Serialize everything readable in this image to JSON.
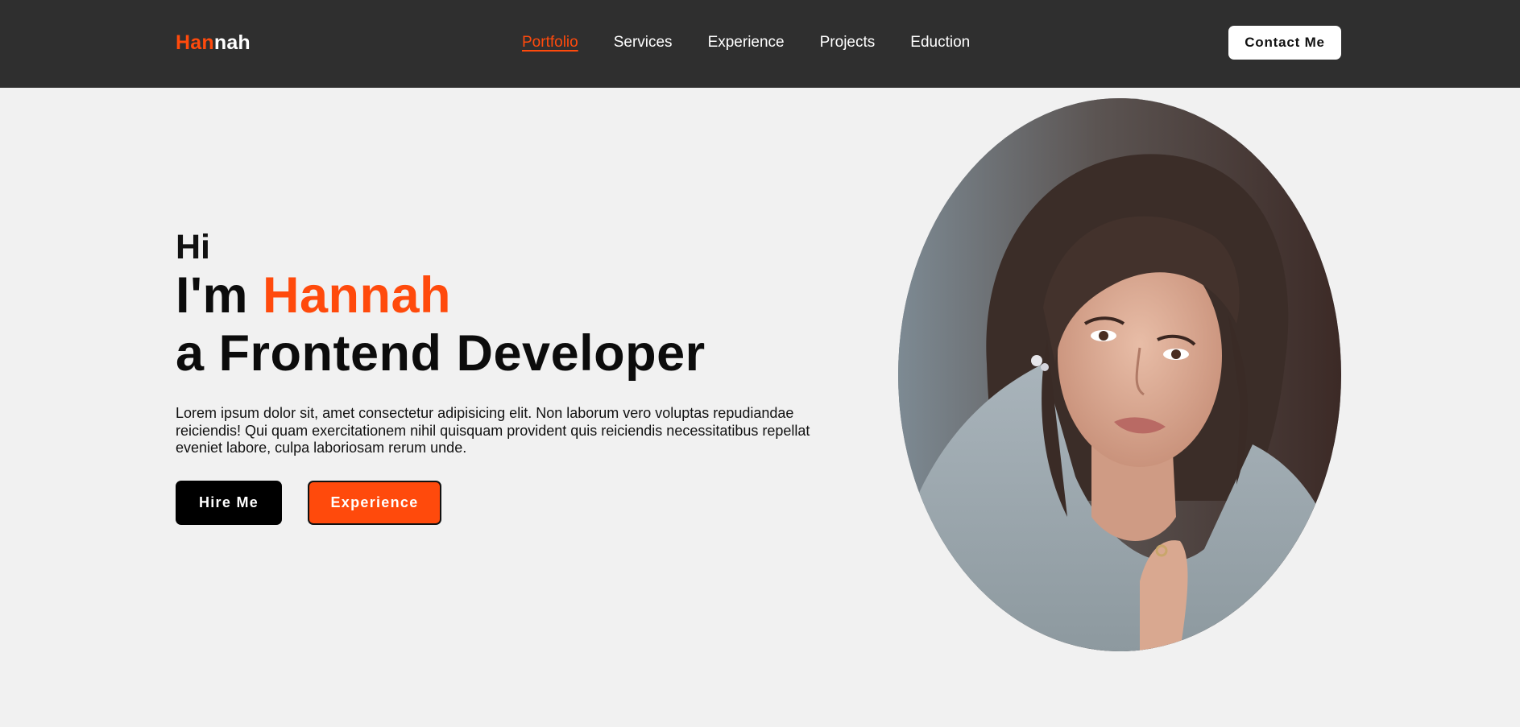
{
  "header": {
    "logo_accent": "Han",
    "logo_rest": "nah",
    "nav": [
      {
        "label": "Portfolio",
        "active": true
      },
      {
        "label": "Services",
        "active": false
      },
      {
        "label": "Experience",
        "active": false
      },
      {
        "label": "Projects",
        "active": false
      },
      {
        "label": "Eduction",
        "active": false
      }
    ],
    "contact_label": "Contact Me"
  },
  "hero": {
    "greeting": "Hi",
    "intro_prefix": "I'm ",
    "name": "Hannah",
    "role": "a Frontend Developer",
    "description": "Lorem ipsum dolor sit, amet consectetur adipisicing elit. Non laborum vero voluptas repudiandae reiciendis! Qui quam exercitationem nihil quisquam provident quis reiciendis necessitatibus repellat eveniet labore, culpa laboriosam rerum unde.",
    "hire_label": "Hire Me",
    "experience_label": "Experience"
  },
  "colors": {
    "accent": "#ff4a0c",
    "header_bg": "#2f2f2f",
    "page_bg": "#f1f1f1"
  },
  "portrait_icon": "profile-photo"
}
